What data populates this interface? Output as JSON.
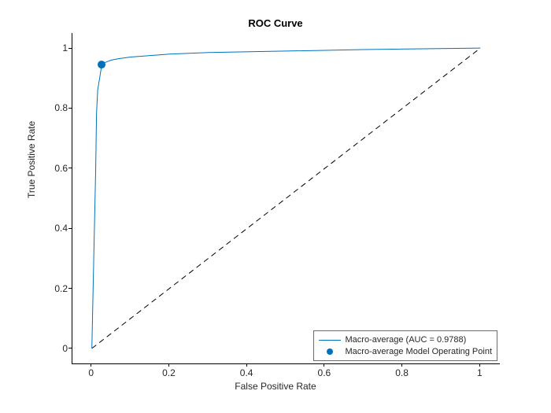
{
  "title": "ROC Curve",
  "xlabel": "False Positive Rate",
  "ylabel": "True Positive Rate",
  "legend": {
    "line": "Macro-average (AUC = 0.9788)",
    "point": "Macro-average Model Operating Point"
  },
  "ticks": {
    "x": [
      "0",
      "0.2",
      "0.4",
      "0.6",
      "0.8",
      "1"
    ],
    "y": [
      "0",
      "0.2",
      "0.4",
      "0.6",
      "0.8",
      "1"
    ]
  },
  "chart_data": {
    "type": "line",
    "title": "ROC Curve",
    "xlabel": "False Positive Rate",
    "ylabel": "True Positive Rate",
    "xlim": [
      -0.05,
      1.05
    ],
    "ylim": [
      -0.05,
      1.05
    ],
    "series": [
      {
        "name": "Macro-average (AUC = 0.9788)",
        "x": [
          0.0,
          0.005,
          0.01,
          0.012,
          0.015,
          0.02,
          0.025,
          0.03,
          0.04,
          0.05,
          0.07,
          0.1,
          0.15,
          0.2,
          0.3,
          0.5,
          0.7,
          1.0
        ],
        "y": [
          0.0,
          0.3,
          0.6,
          0.78,
          0.86,
          0.9,
          0.94,
          0.95,
          0.955,
          0.96,
          0.965,
          0.97,
          0.975,
          0.98,
          0.985,
          0.99,
          0.995,
          1.0
        ]
      },
      {
        "name": "Diagonal",
        "x": [
          0,
          1
        ],
        "y": [
          0,
          1
        ],
        "style": "dashed"
      }
    ],
    "operating_point": {
      "x": 0.025,
      "y": 0.945
    },
    "auc": 0.9788
  }
}
